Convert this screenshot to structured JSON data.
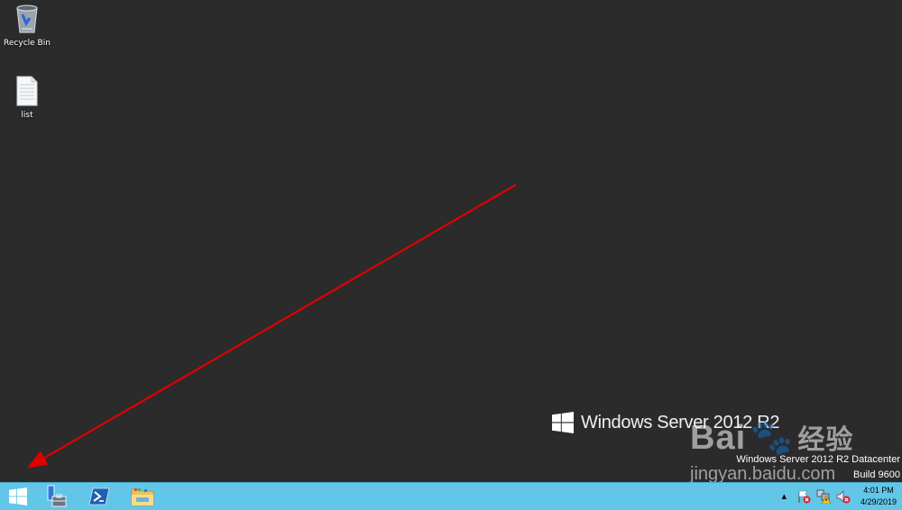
{
  "desktop": {
    "icons": [
      {
        "label": "Recycle Bin",
        "icon": "recycle-bin-icon"
      },
      {
        "label": "list",
        "icon": "text-file-icon"
      }
    ],
    "branding": {
      "product": "Windows Server 2012 R2",
      "edition": "Windows Server 2012 R2 Datacenter",
      "build": "Build 9600"
    },
    "annotation": {
      "type": "arrow",
      "color": "#e00000",
      "points_to": "start-button"
    },
    "watermark": {
      "brand": "Bai",
      "suffix": "经验",
      "url": "jingyan.baidu.com"
    }
  },
  "taskbar": {
    "color": "#62c6e8",
    "pinned": [
      {
        "name": "start-button",
        "icon": "windows-logo-icon"
      },
      {
        "name": "server-manager-button",
        "icon": "server-manager-icon"
      },
      {
        "name": "powershell-button",
        "icon": "powershell-icon"
      },
      {
        "name": "file-explorer-button",
        "icon": "folder-icon"
      }
    ],
    "tray": {
      "show_hidden": "▲",
      "icons": [
        "action-center-flag-icon",
        "network-warning-icon",
        "speaker-muted-icon"
      ],
      "time": "4:01 PM",
      "date": "4/29/2019"
    }
  }
}
